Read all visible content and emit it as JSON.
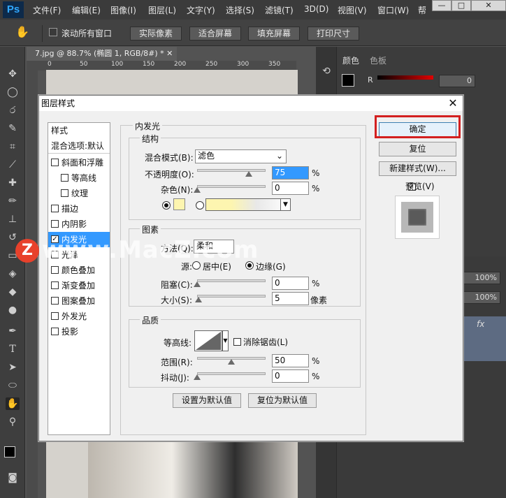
{
  "app": {
    "logo": "Ps"
  },
  "menu": [
    "文件(F)",
    "编辑(E)",
    "图像(I)",
    "图层(L)",
    "文字(Y)",
    "选择(S)",
    "滤镜(T)",
    "3D(D)",
    "视图(V)",
    "窗口(W)",
    "帮"
  ],
  "options_bar": {
    "scroll_all": "滚动所有窗口",
    "actual_pixels": "实际像素",
    "fit_screen": "适合屏幕",
    "fill_screen": "填充屏幕",
    "print_size": "打印尺寸"
  },
  "document": {
    "tab": "7.jpg @ 88.7% (椭圆 1, RGB/8#) *",
    "ruler": [
      "0",
      "50",
      "100",
      "150",
      "200",
      "250",
      "300",
      "350"
    ]
  },
  "right_panel": {
    "tabs": [
      "颜色",
      "色板"
    ],
    "r_label": "R",
    "r_value": "0",
    "opacity1": "100%",
    "opacity2": "100%",
    "fx": "fx"
  },
  "dialog": {
    "title": "图层样式",
    "styles_header": "样式",
    "blend_default": "混合选项:默认",
    "styles": [
      {
        "label": "斜面和浮雕",
        "checked": false,
        "indent": false
      },
      {
        "label": "等高线",
        "checked": false,
        "indent": true
      },
      {
        "label": "纹理",
        "checked": false,
        "indent": true
      },
      {
        "label": "描边",
        "checked": false,
        "indent": false
      },
      {
        "label": "内阴影",
        "checked": false,
        "indent": false
      },
      {
        "label": "内发光",
        "checked": true,
        "indent": false
      },
      {
        "label": "光泽",
        "checked": false,
        "indent": false
      },
      {
        "label": "颜色叠加",
        "checked": false,
        "indent": false
      },
      {
        "label": "渐变叠加",
        "checked": false,
        "indent": false
      },
      {
        "label": "图案叠加",
        "checked": false,
        "indent": false
      },
      {
        "label": "外发光",
        "checked": false,
        "indent": false
      },
      {
        "label": "投影",
        "checked": false,
        "indent": false
      }
    ],
    "section_title": "内发光",
    "structure": {
      "title": "结构",
      "blend_mode_label": "混合模式(B):",
      "blend_mode_value": "滤色",
      "opacity_label": "不透明度(O):",
      "opacity_value": "75",
      "opacity_pct": 0.75,
      "noise_label": "杂色(N):",
      "noise_value": "0",
      "noise_pct": 0.0,
      "unit": "%",
      "color_swatch": "#fdf5b0"
    },
    "elements": {
      "title": "图素",
      "method_label": "方法(Q):",
      "method_value": "柔和",
      "source_label": "源:",
      "source_center": "居中(E)",
      "source_edge": "边缘(G)",
      "choke_label": "阻塞(C):",
      "choke_value": "0",
      "choke_pct": 0.0,
      "size_label": "大小(S):",
      "size_value": "5",
      "size_unit": "像素",
      "size_pct": 0.02
    },
    "quality": {
      "title": "品质",
      "contour_label": "等高线:",
      "antialias_label": "消除锯齿(L)",
      "range_label": "范围(R):",
      "range_value": "50",
      "range_pct": 0.5,
      "jitter_label": "抖动(J):",
      "jitter_value": "0",
      "jitter_pct": 0.0
    },
    "set_default": "设置为默认值",
    "reset_default": "复位为默认值",
    "ok": "确定",
    "reset": "复位",
    "new_style": "新建样式(W)...",
    "preview_label": "预览(V)",
    "close_glyph": "✕"
  },
  "watermark": {
    "logo": "Z",
    "text": "www.MacZ.com"
  },
  "colors": {
    "accent_selected": "#3399ff",
    "highlight_box": "#d32020"
  }
}
